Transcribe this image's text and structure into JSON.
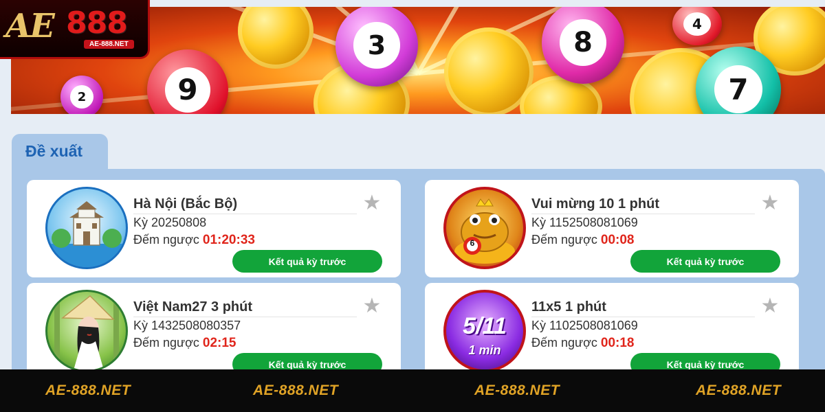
{
  "logo": {
    "ae": "AE",
    "num": "888",
    "site": "AE-888.NET"
  },
  "banner": {
    "balls": [
      "2",
      "9",
      "3",
      "8",
      "4",
      "7"
    ]
  },
  "section": {
    "tab_label": "Đề xuất"
  },
  "cards": [
    {
      "title": "Hà Nội (Bắc Bộ)",
      "period": "Kỳ 20250808",
      "countdown_label": "Đếm ngược",
      "countdown_value": "01:20:33",
      "button": "Kết quả kỳ trước",
      "avatar_badge": ""
    },
    {
      "title": "Vui mừng 10 1 phút",
      "period": "Kỳ 1152508081069",
      "countdown_label": "Đếm ngược",
      "countdown_value": "00:08",
      "button": "Kết quả kỳ trước",
      "avatar_badge": "6"
    },
    {
      "title": "Việt Nam27 3 phút",
      "period": "Kỳ 1432508080357",
      "countdown_label": "Đếm ngược",
      "countdown_value": "02:15",
      "button": "Kết quả kỳ trước",
      "avatar_badge": ""
    },
    {
      "title": "11x5 1 phút",
      "period": "Kỳ 1102508081069",
      "countdown_label": "Đếm ngược",
      "countdown_value": "00:18",
      "button": "Kết quả kỳ trước",
      "avatar_badge": "5/11",
      "avatar_sub": "1 min"
    }
  ],
  "footer": {
    "watermarks": [
      "AE-888.NET",
      "AE-888.NET",
      "AE-888.NET",
      "AE-888.NET"
    ]
  },
  "colors": {
    "accent_blue": "#1e63b3",
    "panel": "#a9c7e8",
    "countdown": "#e0251b",
    "button": "#12a43a",
    "logo_red": "#e21b1b"
  },
  "icons": [
    "star-icon"
  ]
}
